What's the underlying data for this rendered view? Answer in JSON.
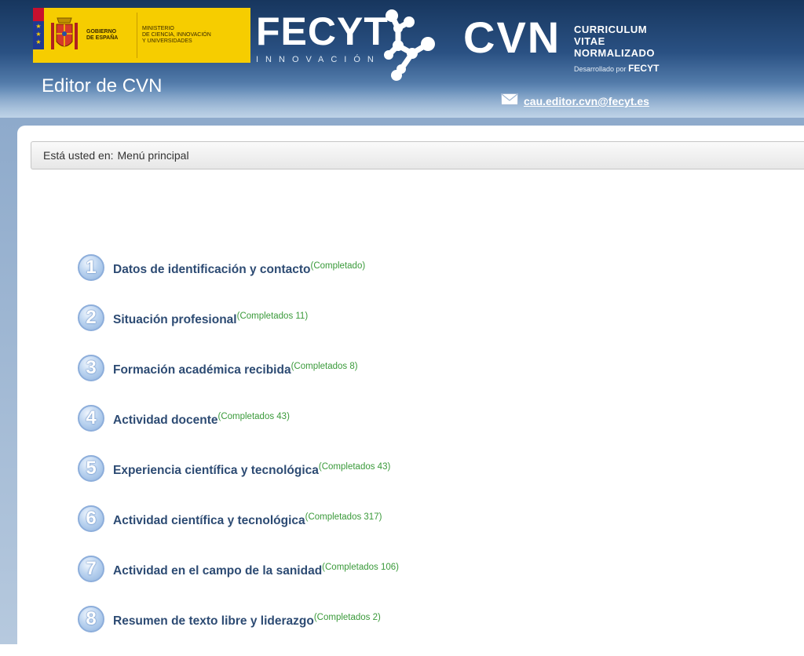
{
  "header": {
    "gov_text": "GOBIERNO\nDE ESPAÑA",
    "ministry_text": "MINISTERIO\nDE CIENCIA, INNOVACIÓN\nY UNIVERSIDADES",
    "fecyt_word": "FECYT",
    "fecyt_sub": "INNOVACIÓN",
    "cvn_word": "CVN",
    "cvn_line1": "CURRICULUM",
    "cvn_line2": "VITAE",
    "cvn_line3": "NORMALIZADO",
    "developed_by": "Desarrollado por",
    "developed_by_brand": "FECYT",
    "app_title": "Editor de CVN",
    "contact_email": "cau.editor.cvn@fecyt.es",
    "contact_icon": "envelope-icon"
  },
  "breadcrumb": {
    "label": "Está usted en:",
    "current": "Menú principal"
  },
  "menu": {
    "items": [
      {
        "number": "1",
        "label": "Datos de identificación y contacto",
        "status": "(Completado)"
      },
      {
        "number": "2",
        "label": "Situación profesional",
        "status": "(Completados 11)"
      },
      {
        "number": "3",
        "label": "Formación académica recibida",
        "status": "(Completados 8)"
      },
      {
        "number": "4",
        "label": "Actividad docente",
        "status": "(Completados 43)"
      },
      {
        "number": "5",
        "label": "Experiencia científica y tecnológica",
        "status": "(Completados 43)"
      },
      {
        "number": "6",
        "label": "Actividad científica y tecnológica",
        "status": "(Completados 317)"
      },
      {
        "number": "7",
        "label": "Actividad en el campo de la sanidad",
        "status": "(Completados 106)"
      },
      {
        "number": "8",
        "label": "Resumen de texto libre y liderazgo",
        "status": "(Completados 2)"
      }
    ]
  },
  "colors": {
    "header_dark": "#17365e",
    "link": "#2d4b73",
    "status": "#3a9a3a",
    "gov_yellow": "#f6cd00"
  }
}
